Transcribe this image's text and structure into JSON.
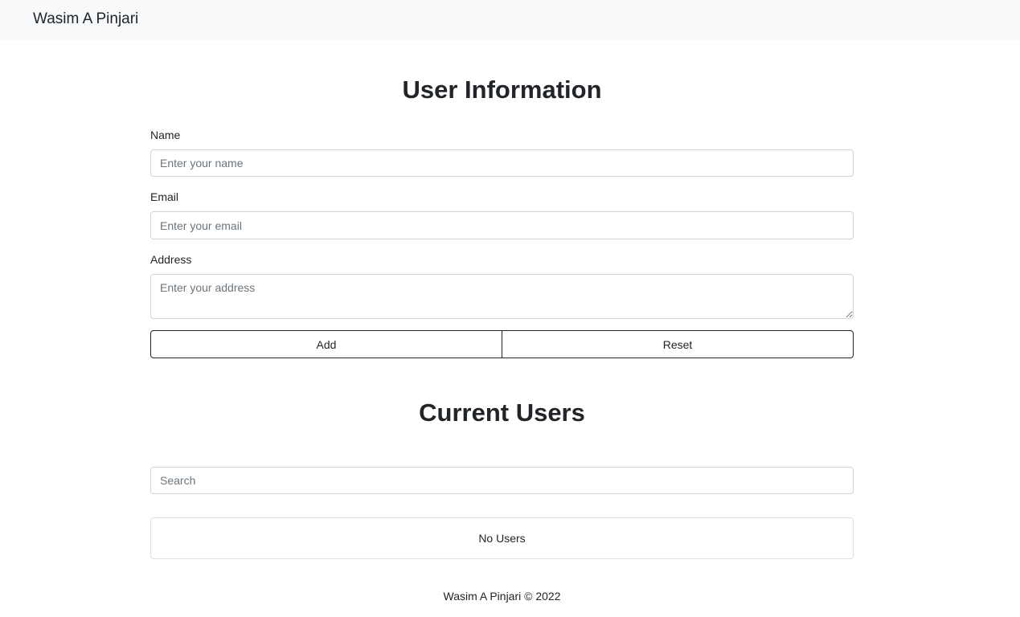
{
  "navbar": {
    "brand": "Wasim A Pinjari"
  },
  "form": {
    "title": "User Information",
    "name": {
      "label": "Name",
      "placeholder": "Enter your name",
      "value": ""
    },
    "email": {
      "label": "Email",
      "placeholder": "Enter your email",
      "value": ""
    },
    "address": {
      "label": "Address",
      "placeholder": "Enter your address",
      "value": ""
    },
    "add_label": "Add",
    "reset_label": "Reset"
  },
  "users": {
    "title": "Current Users",
    "search_placeholder": "Search",
    "empty_text": "No Users"
  },
  "footer": {
    "text": "Wasim A Pinjari © 2022"
  }
}
